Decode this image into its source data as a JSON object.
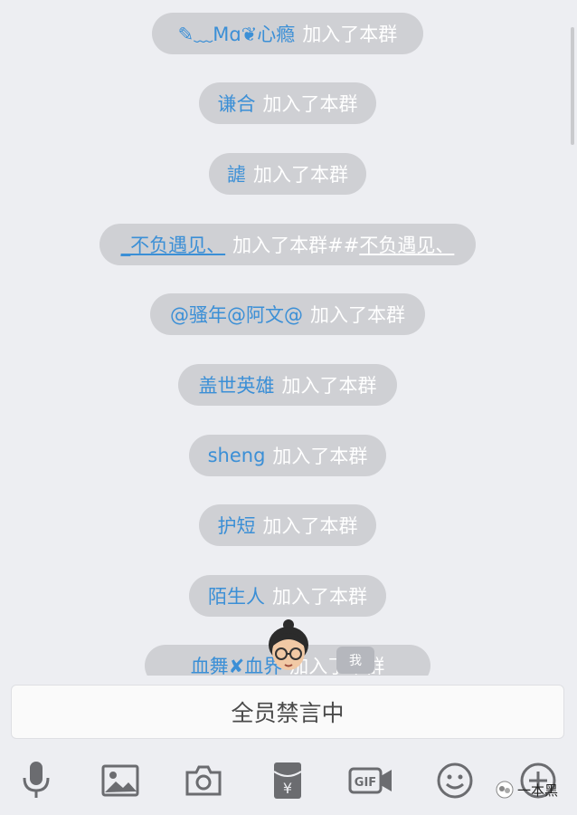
{
  "messages": [
    {
      "name": "✎﹏Mɑ❦心瘾",
      "action": "加入了本群"
    },
    {
      "name": "谦合",
      "action": "加入了本群"
    },
    {
      "name": "謔",
      "action": "加入了本群"
    },
    {
      "name": "_不负遇见、",
      "action": "加入了本群##",
      "suffix": "不负遇见、"
    },
    {
      "name": "@骚年@阿文@",
      "action": "加入了本群"
    },
    {
      "name": "盖世英雄",
      "action": "加入了本群"
    },
    {
      "name": "sheng",
      "action": "加入了本群"
    },
    {
      "name": "护短",
      "action": "加入了本群"
    },
    {
      "name": "陌生人",
      "action": "加入了本群"
    },
    {
      "name": "血舞✘血界",
      "action": "加入了本群"
    }
  ],
  "me_badge": "我",
  "mute_notice": "全员禁言中",
  "toolbar": {
    "icons": [
      "microphone-icon",
      "image-icon",
      "camera-icon",
      "red-packet-icon",
      "gif-icon",
      "emoji-icon",
      "plus-icon"
    ],
    "gif_label": "GIF",
    "red_packet_label": "¥"
  },
  "watermark": "一本黑",
  "colors": {
    "name": "#3b8fd6",
    "pill": "#cfd0d4",
    "background": "#edeef2"
  }
}
